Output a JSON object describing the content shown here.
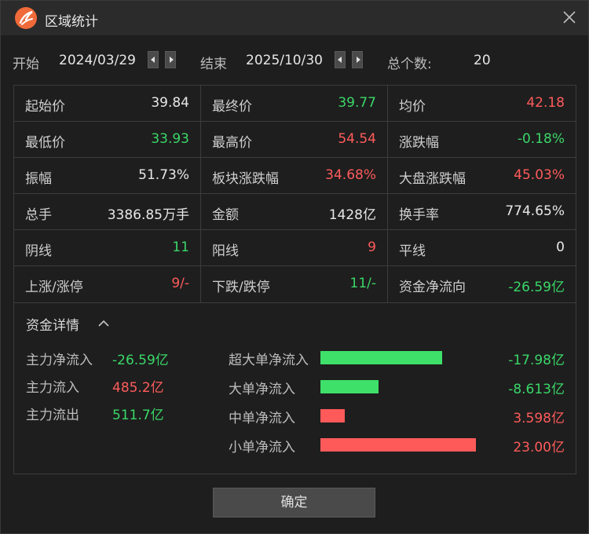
{
  "window": {
    "title": "区域统计"
  },
  "range": {
    "start_label": "开始",
    "start_date": "2024/03/29",
    "end_label": "结束",
    "end_date": "2025/10/30",
    "count_label": "总个数:",
    "count_value": "20"
  },
  "stats": [
    [
      {
        "k": "起始价",
        "v": "39.84",
        "c": "white"
      },
      {
        "k": "最终价",
        "v": "39.77",
        "c": "green"
      },
      {
        "k": "均价",
        "v": "42.18",
        "c": "red"
      }
    ],
    [
      {
        "k": "最低价",
        "v": "33.93",
        "c": "green"
      },
      {
        "k": "最高价",
        "v": "54.54",
        "c": "red"
      },
      {
        "k": "涨跌幅",
        "v": "-0.18%",
        "c": "green"
      }
    ],
    [
      {
        "k": "振幅",
        "v": "51.73%",
        "c": "white"
      },
      {
        "k": "板块涨跌幅",
        "v": "34.68%",
        "c": "red"
      },
      {
        "k": "大盘涨跌幅",
        "v": "45.03%",
        "c": "red"
      }
    ],
    [
      {
        "k": "总手",
        "v": "3386.85万手",
        "c": "white"
      },
      {
        "k": "金额",
        "v": "1428亿",
        "c": "white"
      },
      {
        "k": "换手率",
        "v": "774.65%",
        "c": "white"
      }
    ],
    [
      {
        "k": "阴线",
        "v": "11",
        "c": "green"
      },
      {
        "k": "阳线",
        "v": "9",
        "c": "red"
      },
      {
        "k": "平线",
        "v": "0",
        "c": "white"
      }
    ],
    [
      {
        "k": "上涨/涨停",
        "v": "9/-",
        "c": "red"
      },
      {
        "k": "下跌/跌停",
        "v": "11/-",
        "c": "green"
      },
      {
        "k": "资金净流向",
        "v": "-26.59亿",
        "c": "green"
      }
    ]
  ],
  "capital": {
    "title": "资金详情",
    "main": [
      {
        "k": "主力净流入",
        "v": "-26.59亿",
        "c": "green"
      },
      {
        "k": "主力流入",
        "v": "485.2亿",
        "c": "red"
      },
      {
        "k": "主力流出",
        "v": "511.7亿",
        "c": "green"
      }
    ],
    "flows": [
      {
        "k": "超大单净流入",
        "v": "-17.98亿",
        "amount": -17.98,
        "c": "green"
      },
      {
        "k": "大单净流入",
        "v": "-8.613亿",
        "amount": -8.613,
        "c": "green"
      },
      {
        "k": "中单净流入",
        "v": "3.598亿",
        "amount": 3.598,
        "c": "red"
      },
      {
        "k": "小单净流入",
        "v": "23.00亿",
        "amount": 23.0,
        "c": "red"
      }
    ]
  },
  "colors": {
    "red": "#ff5b5b",
    "green": "#3ad768",
    "bar_green": "#3ee06a",
    "bar_red": "#ff5a5a"
  },
  "buttons": {
    "ok_label": "确定"
  }
}
